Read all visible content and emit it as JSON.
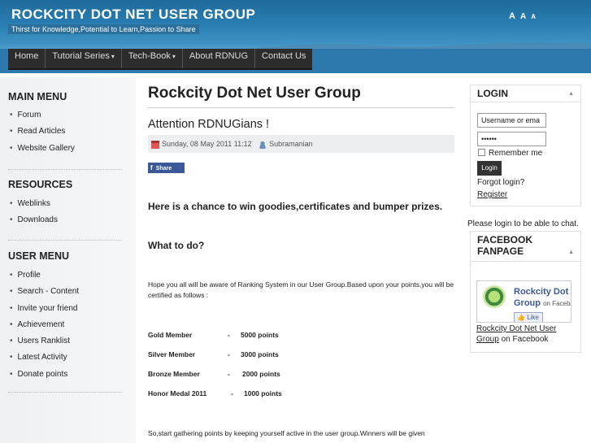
{
  "header": {
    "site_title": "ROCKCITY DOT NET USER GROUP",
    "tagline": "Thirst for Knowledge,Potential to Learn,Passion to Share",
    "font_tools": [
      "A",
      "A",
      "A"
    ]
  },
  "nav": {
    "items": [
      {
        "label": "Home",
        "has_caret": false
      },
      {
        "label": "Tutorial Series",
        "has_caret": true
      },
      {
        "label": "Tech-Book",
        "has_caret": true
      },
      {
        "label": "About RDNUG",
        "has_caret": false
      },
      {
        "label": "Contact Us",
        "has_caret": false
      }
    ]
  },
  "left": {
    "main_menu": {
      "title": "MAIN MENU",
      "items": [
        "Forum",
        "Read Articles",
        "Website Gallery"
      ]
    },
    "resources": {
      "title": "RESOURCES",
      "items": [
        "Weblinks",
        "Downloads"
      ]
    },
    "user_menu": {
      "title": "USER MENU",
      "items": [
        "Profile",
        "Search - Content",
        "Invite your friend",
        "Achievement",
        "Users Ranklist",
        "Latest Activity",
        "Donate points"
      ]
    }
  },
  "main": {
    "page_title": "Rockcity Dot Net User Group",
    "article_title": "Attention RDNUGians !",
    "date": "Sunday, 08 May 2011 11:12",
    "author": "Subramanian",
    "share_label": "Share",
    "headline": "Here is a chance to win goodies,certificates and bumper prizes.",
    "what_to_do": "What to do?",
    "intro": "Hope you all will be aware of Ranking System in our User Group.Based upon your points,you will be certified as follows :",
    "levels": [
      {
        "level": "Gold Member",
        "points": "5000 points"
      },
      {
        "level": "Silver Member",
        "points": "3000 points"
      },
      {
        "level": "Bronze Member",
        "points": "2000 points"
      },
      {
        "level": "Honor Medal 2011",
        "points": "1000 points"
      }
    ],
    "outro": "So,start gathering points by keeping yourself active in the user group.Winners will be given"
  },
  "right": {
    "login": {
      "title": "LOGIN",
      "username_value": "Username or ema",
      "password_value": "••••••",
      "remember_label": "Remember me",
      "login_button": "Login",
      "forgot": "Forgot login?",
      "register": "Register"
    },
    "please_login": "Please login to be able to chat.",
    "facebook": {
      "title_line1": "FACEBOOK",
      "title_line2": "FANPAGE",
      "widget_name_line1": "Rockcity Dot N",
      "widget_name_line2": "Group",
      "widget_on": "on Facebo",
      "like_label": "Like",
      "link_text": "Rockcity Dot Net User Group",
      "link_suffix": "on Facebook"
    }
  }
}
